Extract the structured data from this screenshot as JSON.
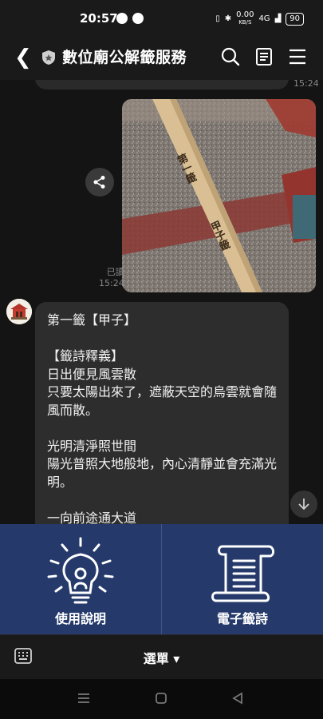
{
  "status": {
    "time": "20:57",
    "net_speed": "0.00",
    "net_unit": "KB/S",
    "signal": "4G",
    "battery": "90"
  },
  "header": {
    "title": "數位廟公解籤服務",
    "icons": [
      "back-icon",
      "shield-icon",
      "search-icon",
      "notes-icon",
      "menu-icon"
    ]
  },
  "chat": {
    "prev_time": "15:24",
    "image_read": "已讀",
    "image_time": "15:24",
    "message_text": "第一籤【甲子】\n\n【籤詩釋義】\n日出便見風雲散\n只要太陽出來了，遮蔽天空的烏雲就會隨風而散。\n\n光明清淨照世間\n陽光普照大地般地，內心清靜並會充滿光明。\n\n一向前途通大道\n好好努力，會通往成功的道路。",
    "photo_marks": [
      "第一籤",
      "甲子籤"
    ]
  },
  "rich_menu": {
    "left_label": "使用說明",
    "right_label": "電子籤詩"
  },
  "bottom": {
    "menu_label": "選單 ▾"
  },
  "colors": {
    "rich_menu_bg": "#253a6b",
    "bubble": "#2d2d2d"
  }
}
